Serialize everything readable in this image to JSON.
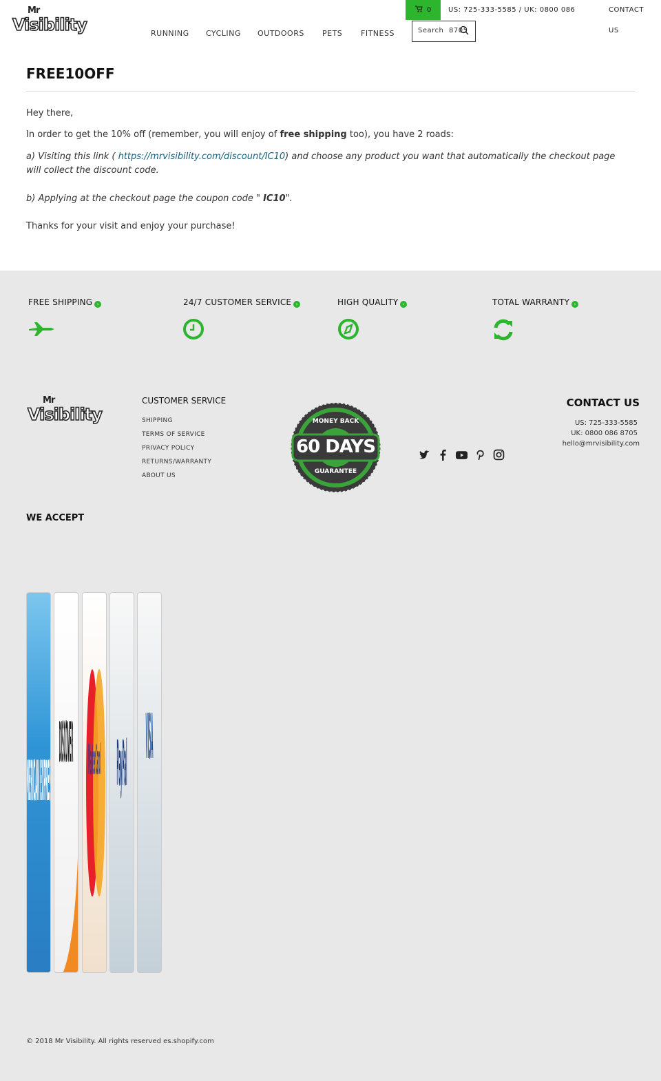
{
  "header": {
    "logo": {
      "top": "Mr",
      "main": "Visibility"
    },
    "nav": [
      "RUNNING",
      "CYCLING",
      "OUTDOORS",
      "PETS",
      "FITNESS"
    ],
    "cart_count": "0",
    "search_placeholder": "Search",
    "search_value": "8705",
    "phone": "US: 725-333-5585 / UK: 0800 086",
    "contact": [
      "CONTACT",
      "US"
    ]
  },
  "page": {
    "title": "FREE10OFF",
    "greeting": "Hey there,",
    "intro_pre": "In order to get the 10% off (remember, you will enjoy of ",
    "intro_bold": "free shipping",
    "intro_post": " too), you have 2 roads:",
    "option_a_pre": "a) Visiting this link ( ",
    "option_a_link": "https://mrvisibility.com/discount/IC10",
    "option_a_post": ") and choose any product you want that automatically the checkout page will collect the discount code.",
    "option_b_pre": "b) Applying at the checkout page the coupon code \" ",
    "option_b_code": "IC10",
    "option_b_post": "\".",
    "thanks": "Thanks for your visit and enjoy your purchase!"
  },
  "features": [
    {
      "label": "FREE SHIPPING",
      "icon": "plane-icon"
    },
    {
      "label": "24/7 CUSTOMER SERVICE",
      "icon": "clock-icon"
    },
    {
      "label": "HIGH QUALITY",
      "icon": "compass-icon"
    },
    {
      "label": "TOTAL WARRANTY",
      "icon": "refresh-icon"
    }
  ],
  "footer": {
    "customer_service_title": "CUSTOMER SERVICE",
    "links": [
      "SHIPPING",
      "TERMS OF SERVICE",
      "PRIVACY POLICY",
      "RETURNS/WARRANTY",
      "ABOUT US"
    ],
    "badge": {
      "top": "MONEY BACK",
      "main": "60 DAYS",
      "bottom": "GUARANTEE"
    },
    "social": [
      "twitter-icon",
      "facebook-icon",
      "youtube-icon",
      "pinterest-icon",
      "instagram-icon"
    ],
    "contact_title": "CONTACT US",
    "contact_lines": [
      "US: 725-333-5585",
      "UK: 0800 086 8705",
      "hello@mrvisibility.com"
    ],
    "we_accept": "WE ACCEPT",
    "cards": [
      "AMERICAN EXPRESS",
      "DISCOVER",
      "MasterCard",
      "PayPal",
      "VISA"
    ],
    "copyright": "© 2018 Mr Visibility. All rights reserved es.shopify.com"
  },
  "colors": {
    "accent": "#2db52d",
    "footer_bg": "#e8e8e8",
    "link": "#1a5f7a"
  }
}
